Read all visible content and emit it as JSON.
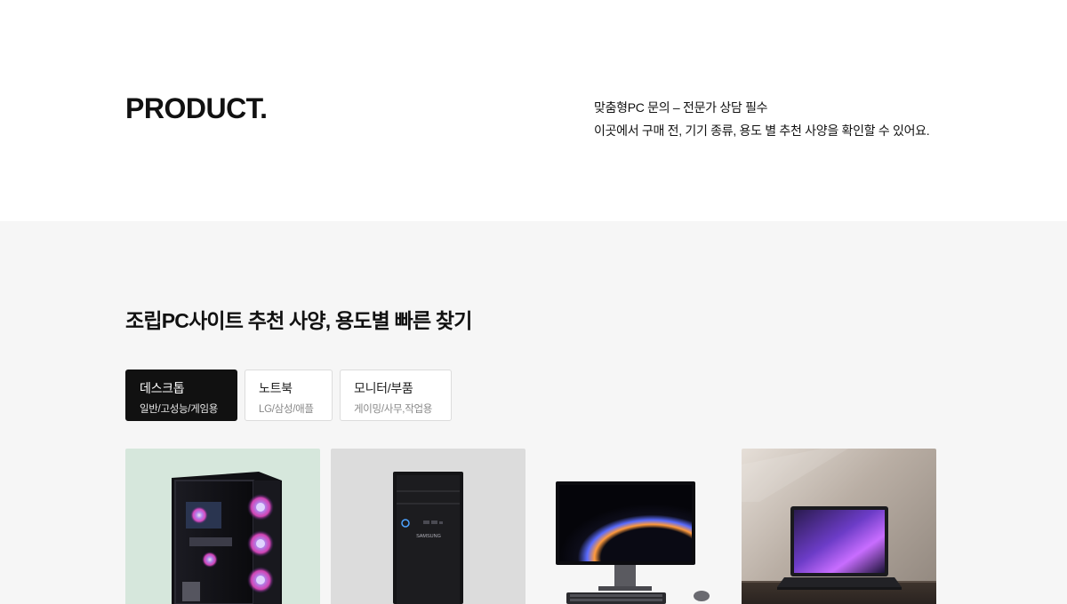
{
  "hero": {
    "title": "PRODUCT.",
    "desc_line1": "맞춤형PC 문의 – 전문가 상담 필수",
    "desc_line2": "이곳에서 구매 전, 기기 종류, 용도 별 추천 사양을 확인할 수 있어요."
  },
  "section": {
    "title": "조립PC사이트 추천 사양, 용도별 빠른 찾기"
  },
  "tabs": [
    {
      "label": "데스크톱",
      "sub": "일반/고성능/게임용",
      "active": true
    },
    {
      "label": "노트북",
      "sub": "LG/삼성/애플",
      "active": false
    },
    {
      "label": "모니터/부품",
      "sub": "게이밍/사무,작업용",
      "active": false
    }
  ],
  "cards": [
    {
      "image": "gaming-pc-tower-rgb-fans-image"
    },
    {
      "image": "samsung-desktop-tower-image"
    },
    {
      "image": "monitor-keyboard-mouse-set-image"
    },
    {
      "image": "laptop-on-desk-image"
    }
  ],
  "products": {
    "tower_brand": "SAMSUNG"
  },
  "colors": {
    "active_tab": "#111111",
    "section_bg": "#f6f6f6",
    "card1_bg": "#d6e7dc",
    "card2_bg": "#dcdcdc"
  }
}
